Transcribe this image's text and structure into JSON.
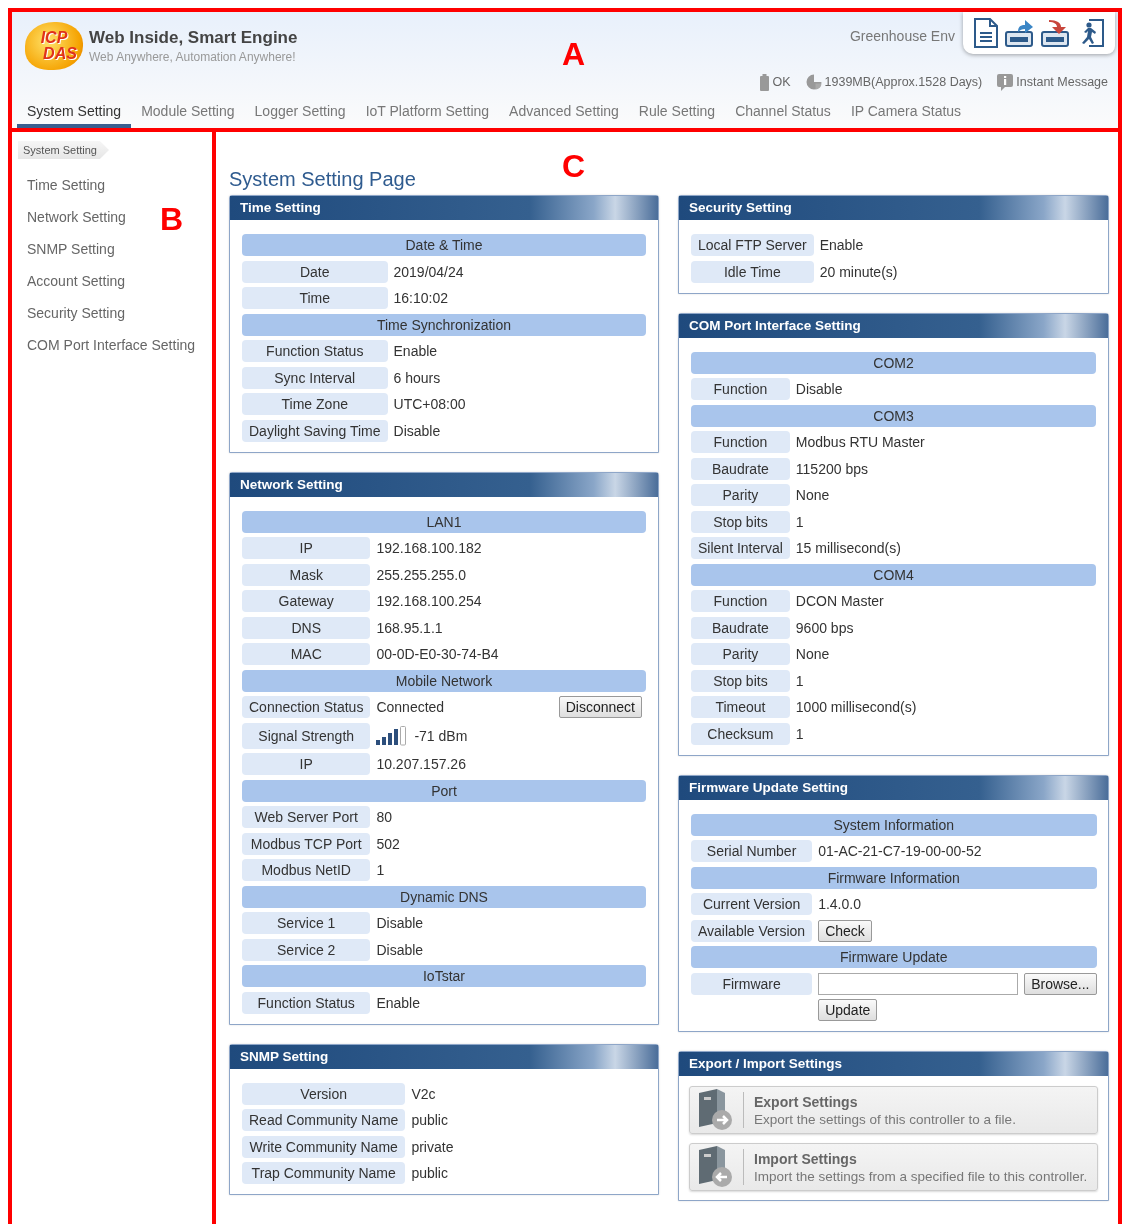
{
  "header": {
    "logo_text": [
      "ICP",
      "DAS"
    ],
    "title": "Web Inside, Smart Engine",
    "subtitle": "Web Anywhere, Automation Anywhere!",
    "device_name": "Greenhouse Env",
    "toolbar": [
      {
        "kind": "document"
      },
      {
        "kind": "upload"
      },
      {
        "kind": "download"
      },
      {
        "kind": "logout"
      }
    ],
    "status": [
      {
        "kind": "battery",
        "text": "OK"
      },
      {
        "kind": "storage",
        "text": "1939MB(Approx.1528 Days)"
      },
      {
        "kind": "message",
        "text": "Instant Message"
      }
    ]
  },
  "tabs": [
    {
      "label": "System Setting",
      "selected": true
    },
    {
      "label": "Module Setting",
      "selected": false
    },
    {
      "label": "Logger Setting",
      "selected": false
    },
    {
      "label": "IoT Platform Setting",
      "selected": false
    },
    {
      "label": "Advanced Setting",
      "selected": false
    },
    {
      "label": "Rule Setting",
      "selected": false
    },
    {
      "label": "Channel Status",
      "selected": false
    },
    {
      "label": "IP Camera Status",
      "selected": false
    }
  ],
  "sidebar": {
    "breadcrumb": "System Setting",
    "items": [
      "Time Setting",
      "Network Setting",
      "SNMP Setting",
      "Account Setting",
      "Security Setting",
      "COM Port Interface Setting"
    ]
  },
  "page_title": "System Setting Page",
  "columns": [
    [
      {
        "title": "Time Setting",
        "rows": [
          {
            "kind": "group",
            "text": "Date & Time"
          },
          {
            "kind": "field",
            "label": "Date",
            "value": "2019/04/24"
          },
          {
            "kind": "field",
            "label": "Time",
            "value": "16:10:02"
          },
          {
            "kind": "group",
            "text": "Time Synchronization"
          },
          {
            "kind": "field",
            "label": "Function Status",
            "value": "Enable"
          },
          {
            "kind": "field",
            "label": "Sync Interval",
            "value": "6 hours"
          },
          {
            "kind": "field",
            "label": "Time Zone",
            "value": "UTC+08:00"
          },
          {
            "kind": "field",
            "label": "Daylight Saving Time",
            "value": "Disable"
          }
        ]
      },
      {
        "title": "Network Setting",
        "rows": [
          {
            "kind": "group",
            "text": "LAN1"
          },
          {
            "kind": "field",
            "label": "IP",
            "value": "192.168.100.182"
          },
          {
            "kind": "field",
            "label": "Mask",
            "value": "255.255.255.0"
          },
          {
            "kind": "field",
            "label": "Gateway",
            "value": "192.168.100.254"
          },
          {
            "kind": "field",
            "label": "DNS",
            "value": "168.95.1.1"
          },
          {
            "kind": "field",
            "label": "MAC",
            "value": "00-0D-E0-30-74-B4"
          },
          {
            "kind": "group",
            "text": "Mobile Network"
          },
          {
            "kind": "field",
            "label": "Connection Status",
            "value": "Connected",
            "button": "Disconnect"
          },
          {
            "kind": "signal",
            "label": "Signal Strength",
            "value": "-71 dBm"
          },
          {
            "kind": "field",
            "label": "IP",
            "value": "10.207.157.26"
          },
          {
            "kind": "group",
            "text": "Port"
          },
          {
            "kind": "field",
            "label": "Web Server Port",
            "value": "80"
          },
          {
            "kind": "field",
            "label": "Modbus TCP Port",
            "value": "502"
          },
          {
            "kind": "field",
            "label": "Modbus NetID",
            "value": "1"
          },
          {
            "kind": "group",
            "text": "Dynamic DNS"
          },
          {
            "kind": "field",
            "label": "Service 1",
            "value": "Disable"
          },
          {
            "kind": "field",
            "label": "Service 2",
            "value": "Disable"
          },
          {
            "kind": "group",
            "text": "IoTstar"
          },
          {
            "kind": "field",
            "label": "Function Status",
            "value": "Enable"
          }
        ]
      },
      {
        "title": "SNMP Setting",
        "rows": [
          {
            "kind": "field",
            "label": "Version",
            "value": "V2c"
          },
          {
            "kind": "field",
            "label": "Read Community Name",
            "value": "public"
          },
          {
            "kind": "field",
            "label": "Write Community Name",
            "value": "private"
          },
          {
            "kind": "field",
            "label": "Trap Community Name",
            "value": "public"
          }
        ]
      }
    ],
    [
      {
        "title": "Security Setting",
        "rows": [
          {
            "kind": "field",
            "label": "Local FTP Server",
            "value": "Enable"
          },
          {
            "kind": "field",
            "label": "Idle Time",
            "value": "20 minute(s)"
          }
        ]
      },
      {
        "title": "COM Port Interface Setting",
        "rows": [
          {
            "kind": "group",
            "text": "COM2"
          },
          {
            "kind": "field",
            "label": "Function",
            "value": "Disable"
          },
          {
            "kind": "group",
            "text": "COM3"
          },
          {
            "kind": "field",
            "label": "Function",
            "value": "Modbus RTU Master"
          },
          {
            "kind": "field",
            "label": "Baudrate",
            "value": "115200 bps"
          },
          {
            "kind": "field",
            "label": "Parity",
            "value": "None"
          },
          {
            "kind": "field",
            "label": "Stop bits",
            "value": "1"
          },
          {
            "kind": "field",
            "label": "Silent Interval",
            "value": "15 millisecond(s)"
          },
          {
            "kind": "group",
            "text": "COM4"
          },
          {
            "kind": "field",
            "label": "Function",
            "value": "DCON Master"
          },
          {
            "kind": "field",
            "label": "Baudrate",
            "value": "9600 bps"
          },
          {
            "kind": "field",
            "label": "Parity",
            "value": "None"
          },
          {
            "kind": "field",
            "label": "Stop bits",
            "value": "1"
          },
          {
            "kind": "field",
            "label": "Timeout",
            "value": "1000 millisecond(s)"
          },
          {
            "kind": "field",
            "label": "Checksum",
            "value": "1"
          }
        ]
      },
      {
        "title": "Firmware Update Setting",
        "rows": [
          {
            "kind": "group",
            "text": "System Information"
          },
          {
            "kind": "field",
            "label": "Serial Number",
            "value": "01-AC-21-C7-19-00-00-52"
          },
          {
            "kind": "group",
            "text": "Firmware Information"
          },
          {
            "kind": "field",
            "label": "Current Version",
            "value": "1.4.0.0"
          },
          {
            "kind": "inline-button",
            "label": "Available Version",
            "button": "Check"
          },
          {
            "kind": "group",
            "text": "Firmware Update"
          },
          {
            "kind": "file",
            "label": "Firmware",
            "button": "Browse..."
          },
          {
            "kind": "action",
            "button": "Update"
          }
        ]
      },
      {
        "title": "Export / Import Settings",
        "cards": [
          {
            "kind": "export",
            "title": "Export Settings",
            "description": "Export the settings of this controller to a file."
          },
          {
            "kind": "import",
            "title": "Import Settings",
            "description": "Import the settings from a specified file to this controller."
          }
        ]
      }
    ]
  ],
  "annotations": [
    {
      "label": "A"
    },
    {
      "label": "B"
    },
    {
      "label": "C"
    }
  ]
}
